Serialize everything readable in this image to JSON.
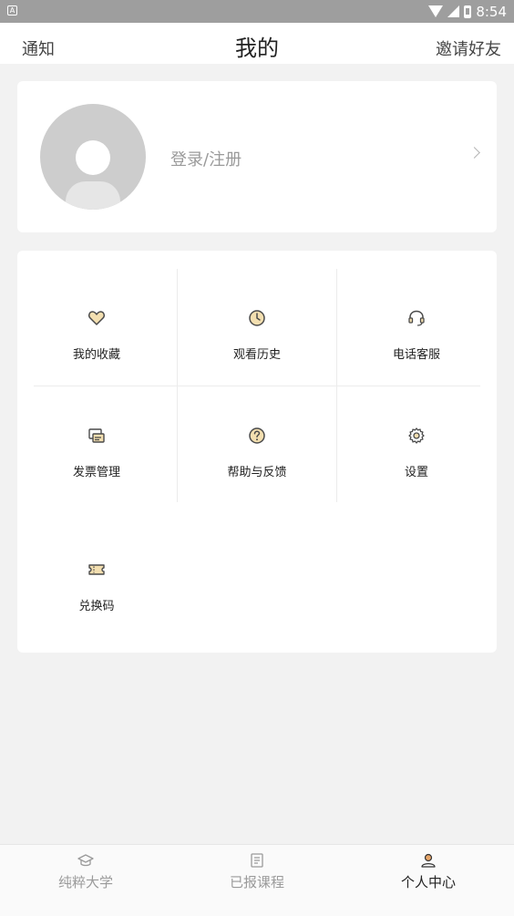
{
  "status_bar": {
    "time": "8:54",
    "left_icon_glyph": "A"
  },
  "header": {
    "left": "通知",
    "title": "我的",
    "right": "邀请好友"
  },
  "profile": {
    "login_label": "登录/注册"
  },
  "menu": {
    "items": [
      {
        "label": "我的收藏",
        "icon": "heart-icon"
      },
      {
        "label": "观看历史",
        "icon": "clock-icon"
      },
      {
        "label": "电话客服",
        "icon": "headset-icon"
      },
      {
        "label": "发票管理",
        "icon": "invoice-icon"
      },
      {
        "label": "帮助与反馈",
        "icon": "help-icon"
      },
      {
        "label": "设置",
        "icon": "gear-icon"
      },
      {
        "label": "兑换码",
        "icon": "ticket-icon"
      }
    ]
  },
  "bottom_nav": {
    "tabs": [
      {
        "label": "纯粹大学",
        "icon": "graduation-cap-icon",
        "active": false
      },
      {
        "label": "已报课程",
        "icon": "course-list-icon",
        "active": false
      },
      {
        "label": "个人中心",
        "icon": "person-icon",
        "active": true
      }
    ]
  },
  "colors": {
    "accent": "#e8a66a",
    "icon_fill": "#f3dfb0",
    "icon_stroke": "#4a4a4a",
    "background": "#f2f2f2"
  }
}
